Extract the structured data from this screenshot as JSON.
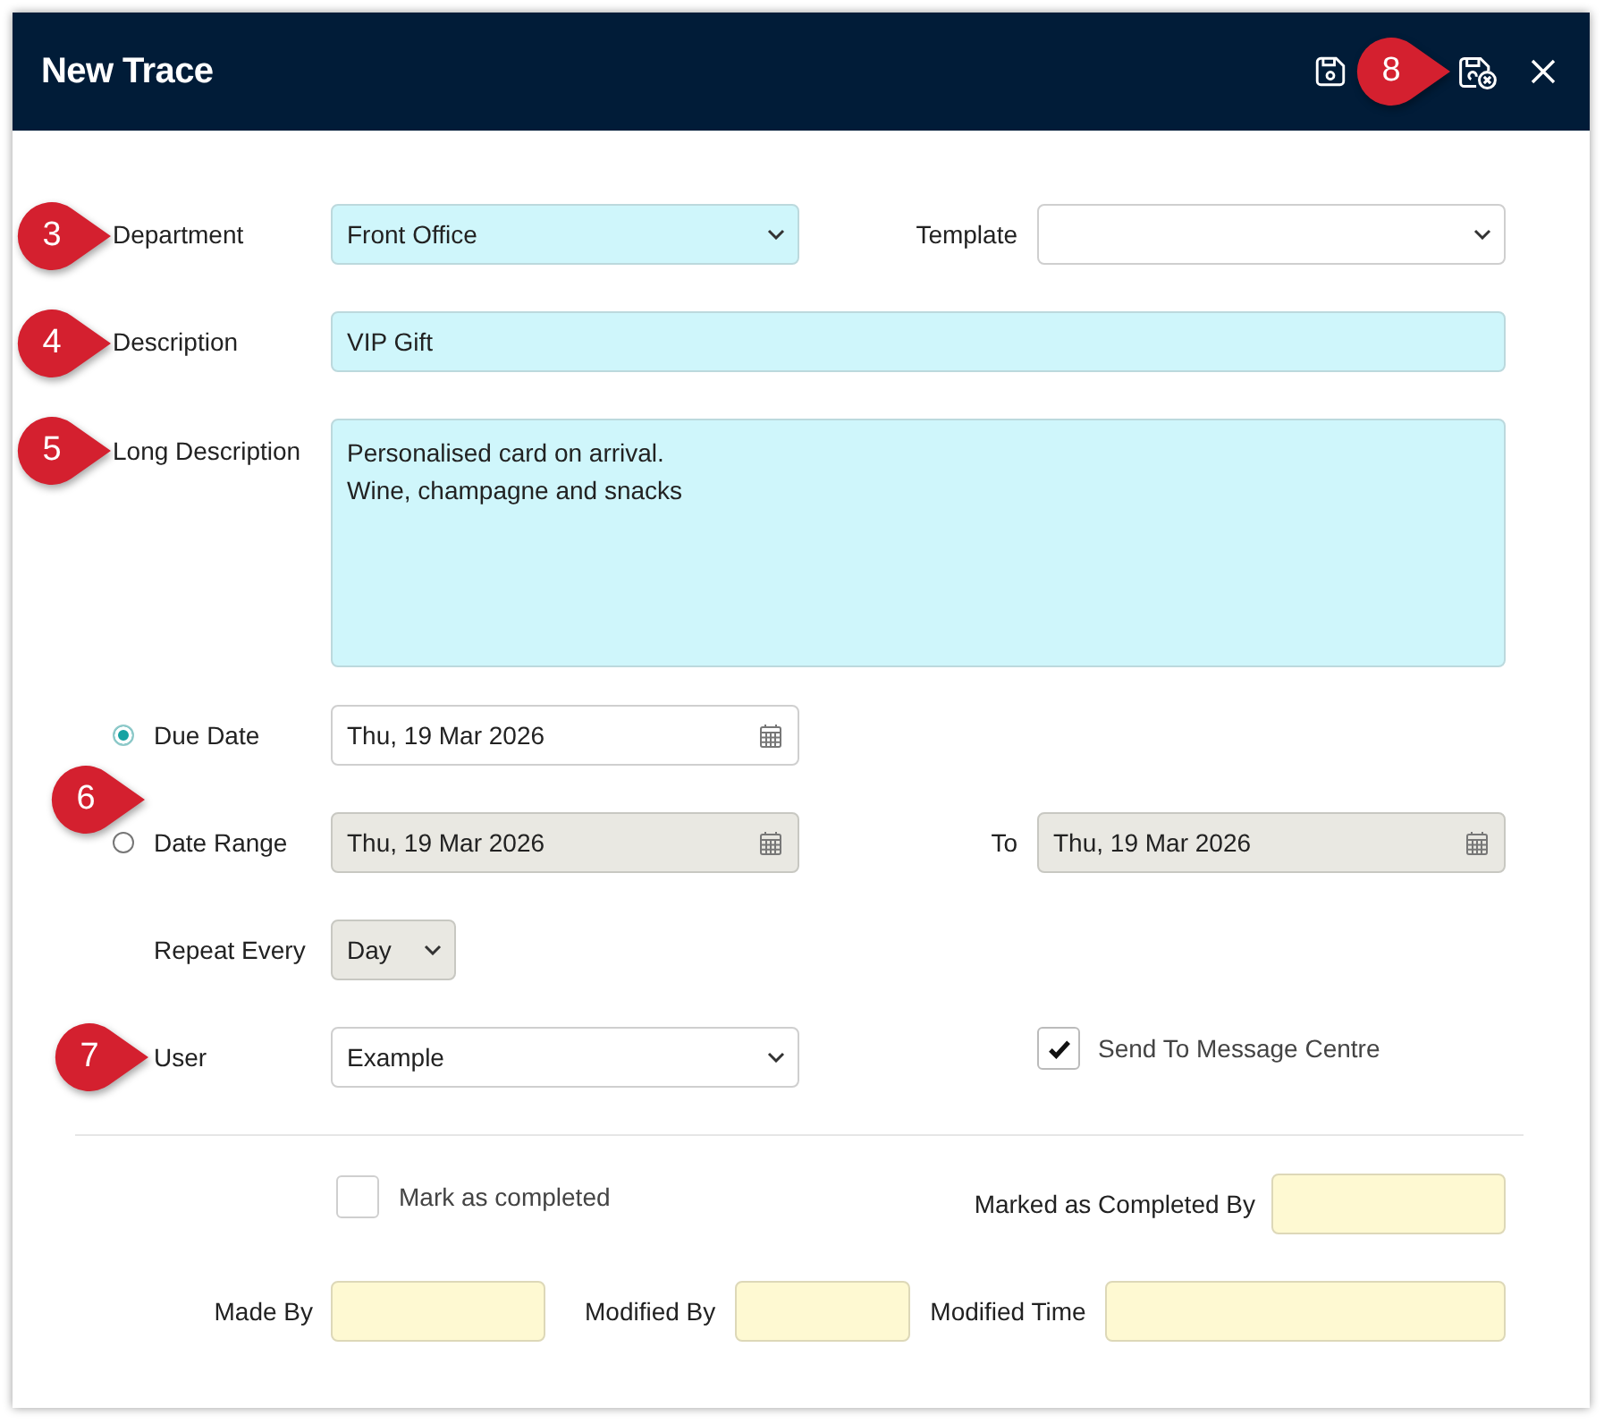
{
  "window": {
    "title": "New Trace"
  },
  "header_actions": [
    {
      "kind": "save"
    },
    {
      "kind": "save_close",
      "callout": "8"
    },
    {
      "kind": "close"
    }
  ],
  "department": {
    "label": "Department",
    "value": "Front Office",
    "required": true,
    "callout": "3"
  },
  "template": {
    "label": "Template",
    "required": false
  },
  "description": {
    "label": "Description",
    "value": "VIP Gift",
    "required": true,
    "callout": "4"
  },
  "long_description": {
    "label": "Long Description",
    "value": "Personalised card on arrival.\nWine, champagne and snacks",
    "required": true,
    "callout": "5"
  },
  "date_options": {
    "callout": "6",
    "options": [
      {
        "label": "Due Date",
        "selected": true,
        "date": {
          "value": "Thu, 19 Mar 2026",
          "disabled": false
        }
      },
      {
        "label": "Date Range",
        "selected": false,
        "date": {
          "value": "Thu, 19 Mar 2026",
          "disabled": true
        },
        "to_label": "To",
        "to_date": {
          "value": "Thu, 19 Mar 2026",
          "disabled": true
        }
      }
    ]
  },
  "repeat_every": {
    "label": "Repeat Every",
    "value": "Day",
    "disabled": true
  },
  "user": {
    "label": "User",
    "value": "Example",
    "required": false,
    "callout": "7"
  },
  "send_to_message_centre": {
    "label": "Send To Message Centre",
    "checked": true
  },
  "mark_as_completed": {
    "label": "Mark as completed",
    "checked": false
  },
  "marked_as_completed_by": {
    "label": "Marked as Completed By",
    "read_only": true
  },
  "made_by": {
    "label": "Made By",
    "read_only": true
  },
  "modified_by": {
    "label": "Modified By",
    "read_only": true
  },
  "modified_time": {
    "label": "Modified Time",
    "read_only": true
  }
}
